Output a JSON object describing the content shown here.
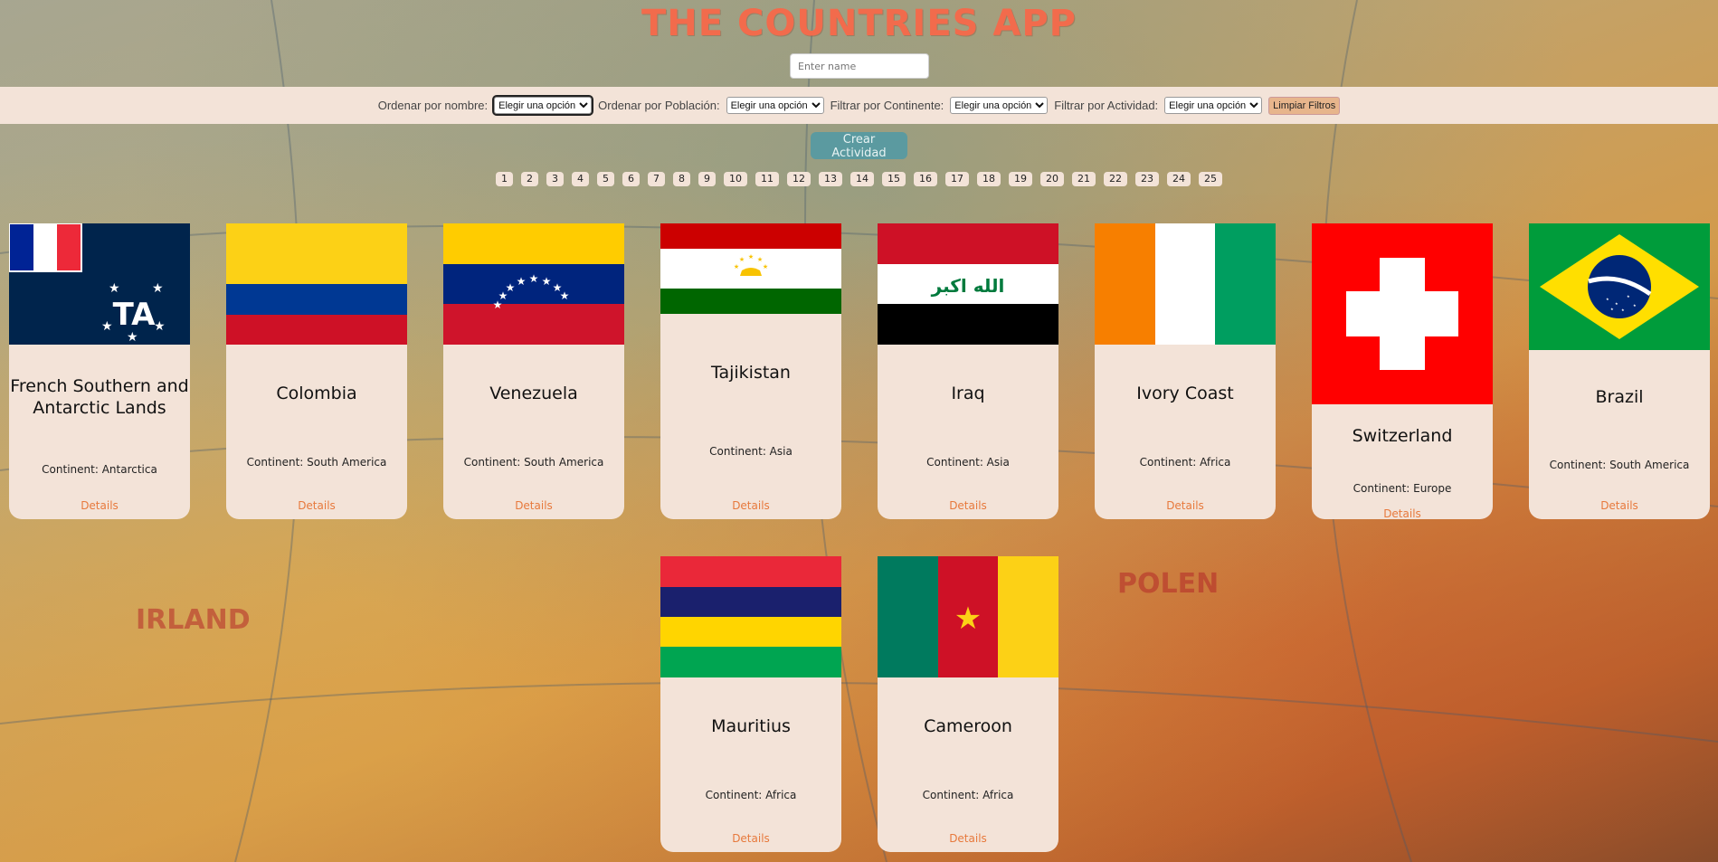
{
  "app": {
    "title": "THE COUNTRIES APP"
  },
  "search": {
    "placeholder": "Enter name"
  },
  "filters": {
    "sort_name_label": "Ordenar por nombre:",
    "sort_pop_label": "Ordenar por Población:",
    "continent_label": "Filtrar por Continente:",
    "activity_label": "Filtrar por Actividad:",
    "select_default": "Elegir una opción",
    "clear_label": "Limpiar Filtros"
  },
  "create_activity_label": "Crear Actividad",
  "pagination": [
    "1",
    "2",
    "3",
    "4",
    "5",
    "6",
    "7",
    "8",
    "9",
    "10",
    "11",
    "12",
    "13",
    "14",
    "15",
    "16",
    "17",
    "18",
    "19",
    "20",
    "21",
    "22",
    "23",
    "24",
    "25"
  ],
  "cards": [
    {
      "name": "French Southern and Antarctic Lands",
      "continent": "Continent: Antarctica",
      "details": "Details",
      "flag": "french-southern-flag"
    },
    {
      "name": "Colombia",
      "continent": "Continent: South America",
      "details": "Details",
      "flag": "colombia-flag"
    },
    {
      "name": "Venezuela",
      "continent": "Continent: South America",
      "details": "Details",
      "flag": "venezuela-flag"
    },
    {
      "name": "Tajikistan",
      "continent": "Continent: Asia",
      "details": "Details",
      "flag": "tajikistan-flag"
    },
    {
      "name": "Iraq",
      "continent": "Continent: Asia",
      "details": "Details",
      "flag": "iraq-flag"
    },
    {
      "name": "Ivory Coast",
      "continent": "Continent: Africa",
      "details": "Details",
      "flag": "ivory-coast-flag"
    },
    {
      "name": "Switzerland",
      "continent": "Continent: Europe",
      "details": "Details",
      "flag": "switzerland-flag"
    },
    {
      "name": "Brazil",
      "continent": "Continent: South America",
      "details": "Details",
      "flag": "brazil-flag"
    },
    {
      "name": "Mauritius",
      "continent": "Continent: Africa",
      "details": "Details",
      "flag": "mauritius-flag"
    },
    {
      "name": "Cameroon",
      "continent": "Continent: Africa",
      "details": "Details",
      "flag": "cameroon-flag"
    }
  ],
  "iraq_flag_text": "الله اكبر"
}
